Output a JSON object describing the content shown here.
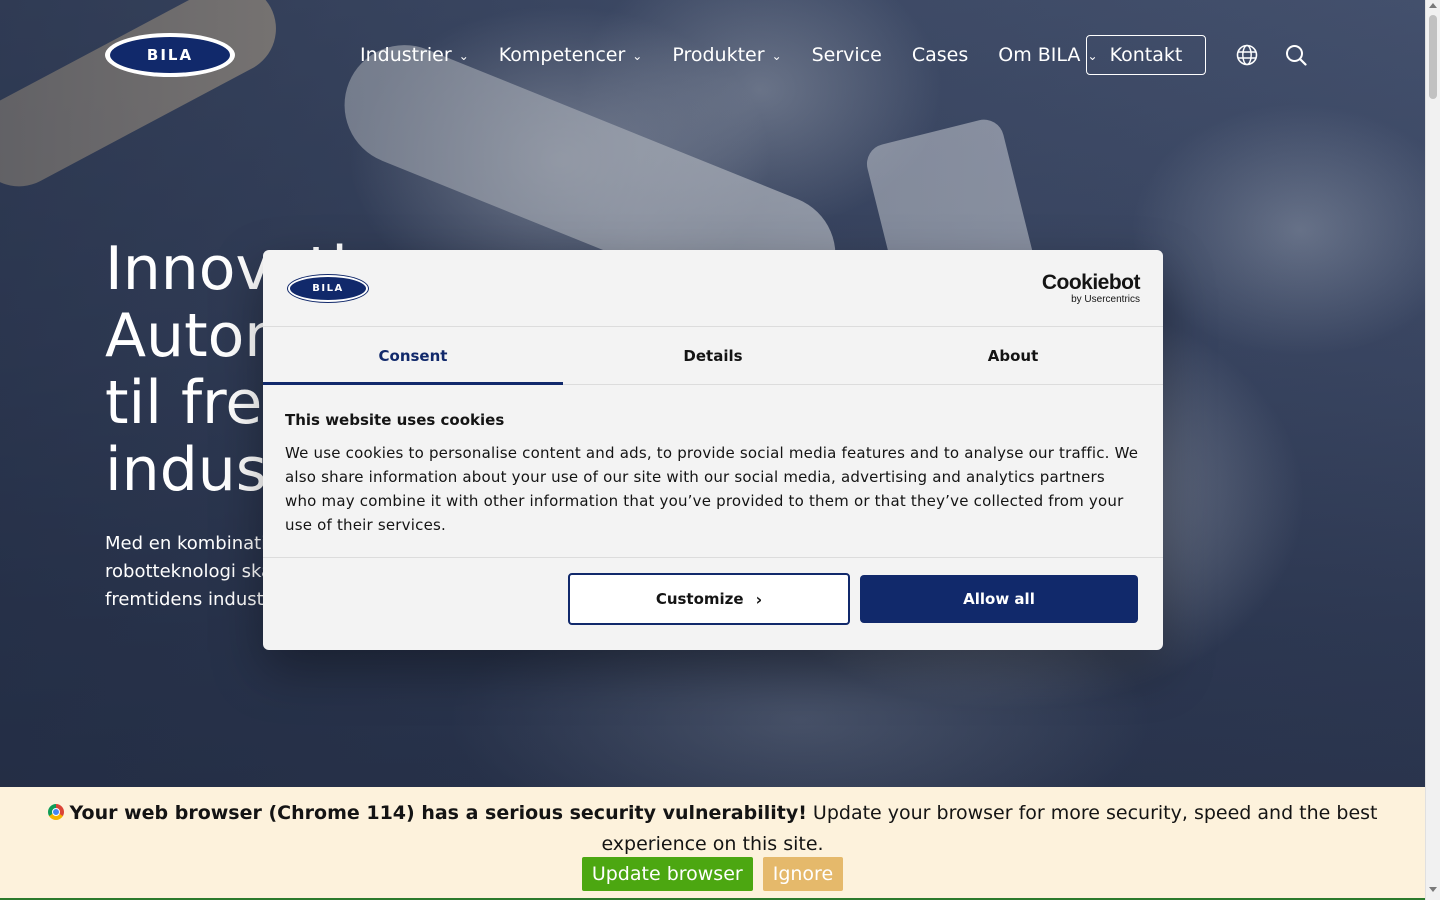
{
  "header": {
    "logo_text": "BILA",
    "nav": [
      {
        "label": "Industrier",
        "has_dropdown": true
      },
      {
        "label": "Kompetencer",
        "has_dropdown": true
      },
      {
        "label": "Produkter",
        "has_dropdown": true
      },
      {
        "label": "Service",
        "has_dropdown": false
      },
      {
        "label": "Cases",
        "has_dropdown": false
      },
      {
        "label": "Om BILA",
        "has_dropdown": true
      }
    ],
    "contact_label": "Kontakt",
    "icons": [
      "globe-icon",
      "search-icon"
    ]
  },
  "hero": {
    "title_lines": [
      "Innovati",
      "Autom",
      "til frem",
      "indust"
    ],
    "subtitle_lines": [
      "Med en kombinati",
      "robotteknologi ska",
      "fremtidens industr"
    ]
  },
  "cookie_dialog": {
    "logo_text": "BILA",
    "brand_main": "Cookiebot",
    "brand_sub": "by Usercentrics",
    "tabs": [
      {
        "label": "Consent",
        "active": true
      },
      {
        "label": "Details",
        "active": false
      },
      {
        "label": "About",
        "active": false
      }
    ],
    "heading": "This website uses cookies",
    "body": "We use cookies to personalise content and ads, to provide social media features and to analyse our traffic. We also share information about your use of our site with our social media, advertising and analytics partners who may combine it with other information that you’ve provided to them or that they’ve collected from your use of their services.",
    "customize_label": "Customize",
    "allow_all_label": "Allow all"
  },
  "update_bar": {
    "warning_bold": "Your web browser (Chrome 114) has a serious security vulnerability!",
    "warning_rest": " Update your browser for more security, speed and the best experience on this site.",
    "update_label": "Update browser",
    "ignore_label": "Ignore"
  },
  "colors": {
    "brand_navy": "#11296b",
    "update_green": "#4ca711",
    "ignore_amber": "#e5b96b",
    "update_bar_bg": "#fdf2dc"
  }
}
